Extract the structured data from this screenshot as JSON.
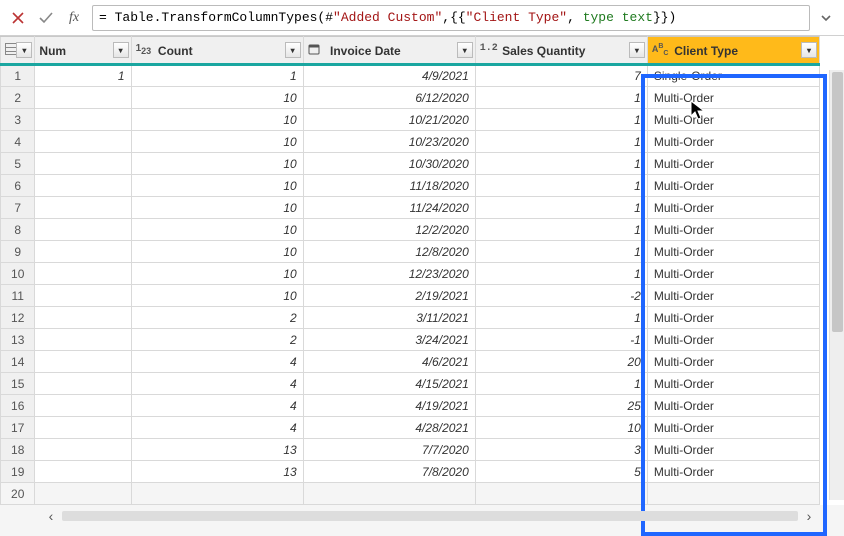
{
  "formula": {
    "prefix": "= Table.TransformColumnTypes(#",
    "str1": "\"Added Custom\"",
    "mid1": ",{{",
    "str2": "\"Client Type\"",
    "mid2": ", ",
    "kw_type": "type",
    "mid3": " ",
    "kw_text": "text",
    "suffix": "}})"
  },
  "columns": {
    "num": {
      "label": "Num",
      "type_prefix": ""
    },
    "count": {
      "label": "Count",
      "type_prefix": "1²₃"
    },
    "invoice": {
      "label": "Invoice Date",
      "type_prefix": "📅"
    },
    "qty": {
      "label": "Sales Quantity",
      "type_prefix": "1.2"
    },
    "client": {
      "label": "Client Type",
      "type_prefix": "ABC"
    }
  },
  "rows": [
    {
      "n": "1",
      "num": "1",
      "count": "1",
      "inv": "4/9/2021",
      "qty": "7",
      "client": "Single-Order"
    },
    {
      "n": "2",
      "num": "",
      "count": "10",
      "inv": "6/12/2020",
      "qty": "1",
      "client": "Multi-Order"
    },
    {
      "n": "3",
      "num": "",
      "count": "10",
      "inv": "10/21/2020",
      "qty": "1",
      "client": "Multi-Order"
    },
    {
      "n": "4",
      "num": "",
      "count": "10",
      "inv": "10/23/2020",
      "qty": "1",
      "client": "Multi-Order"
    },
    {
      "n": "5",
      "num": "",
      "count": "10",
      "inv": "10/30/2020",
      "qty": "1",
      "client": "Multi-Order"
    },
    {
      "n": "6",
      "num": "",
      "count": "10",
      "inv": "11/18/2020",
      "qty": "1",
      "client": "Multi-Order"
    },
    {
      "n": "7",
      "num": "",
      "count": "10",
      "inv": "11/24/2020",
      "qty": "1",
      "client": "Multi-Order"
    },
    {
      "n": "8",
      "num": "",
      "count": "10",
      "inv": "12/2/2020",
      "qty": "1",
      "client": "Multi-Order"
    },
    {
      "n": "9",
      "num": "",
      "count": "10",
      "inv": "12/8/2020",
      "qty": "1",
      "client": "Multi-Order"
    },
    {
      "n": "10",
      "num": "",
      "count": "10",
      "inv": "12/23/2020",
      "qty": "1",
      "client": "Multi-Order"
    },
    {
      "n": "11",
      "num": "",
      "count": "10",
      "inv": "2/19/2021",
      "qty": "-2",
      "client": "Multi-Order"
    },
    {
      "n": "12",
      "num": "",
      "count": "2",
      "inv": "3/11/2021",
      "qty": "1",
      "client": "Multi-Order"
    },
    {
      "n": "13",
      "num": "",
      "count": "2",
      "inv": "3/24/2021",
      "qty": "-1",
      "client": "Multi-Order"
    },
    {
      "n": "14",
      "num": "",
      "count": "4",
      "inv": "4/6/2021",
      "qty": "20",
      "client": "Multi-Order"
    },
    {
      "n": "15",
      "num": "",
      "count": "4",
      "inv": "4/15/2021",
      "qty": "1",
      "client": "Multi-Order"
    },
    {
      "n": "16",
      "num": "",
      "count": "4",
      "inv": "4/19/2021",
      "qty": "25",
      "client": "Multi-Order"
    },
    {
      "n": "17",
      "num": "",
      "count": "4",
      "inv": "4/28/2021",
      "qty": "10",
      "client": "Multi-Order"
    },
    {
      "n": "18",
      "num": "",
      "count": "13",
      "inv": "7/7/2020",
      "qty": "3",
      "client": "Multi-Order"
    },
    {
      "n": "19",
      "num": "",
      "count": "13",
      "inv": "7/8/2020",
      "qty": "5",
      "client": "Multi-Order"
    }
  ],
  "empty_row": "20"
}
